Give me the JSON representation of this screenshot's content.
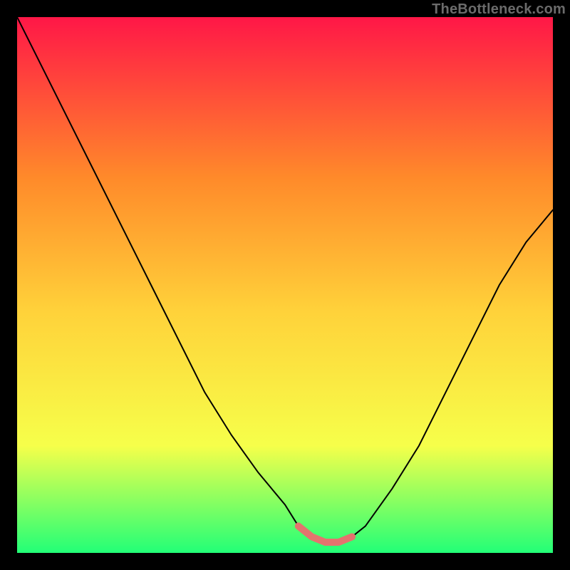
{
  "watermark": "TheBottleneck.com",
  "colors": {
    "frame": "#000000",
    "gradient_top": "#ff1747",
    "gradient_upper_mid": "#ff8a2a",
    "gradient_mid": "#ffd23a",
    "gradient_lower_mid": "#f6ff4a",
    "gradient_bottom": "#22ff77",
    "curve": "#000000",
    "highlight": "#e4736e"
  },
  "chart_data": {
    "type": "line",
    "title": "",
    "xlabel": "",
    "ylabel": "",
    "xlim": [
      0,
      100
    ],
    "ylim": [
      0,
      100
    ],
    "series": [
      {
        "name": "bottleneck-curve",
        "x": [
          0,
          5,
          10,
          15,
          20,
          25,
          30,
          35,
          40,
          45,
          50,
          52.5,
          55,
          57.5,
          60,
          62.5,
          65,
          70,
          75,
          80,
          85,
          90,
          95,
          100
        ],
        "values": [
          100,
          90,
          80,
          70,
          60,
          50,
          40,
          30,
          22,
          15,
          9,
          5,
          3,
          2,
          2,
          3,
          5,
          12,
          20,
          30,
          40,
          50,
          58,
          64
        ]
      },
      {
        "name": "optimal-range-highlight",
        "x": [
          52.5,
          55,
          57.5,
          60,
          62.5
        ],
        "values": [
          5,
          3,
          2,
          2,
          3
        ]
      }
    ],
    "annotations": []
  }
}
